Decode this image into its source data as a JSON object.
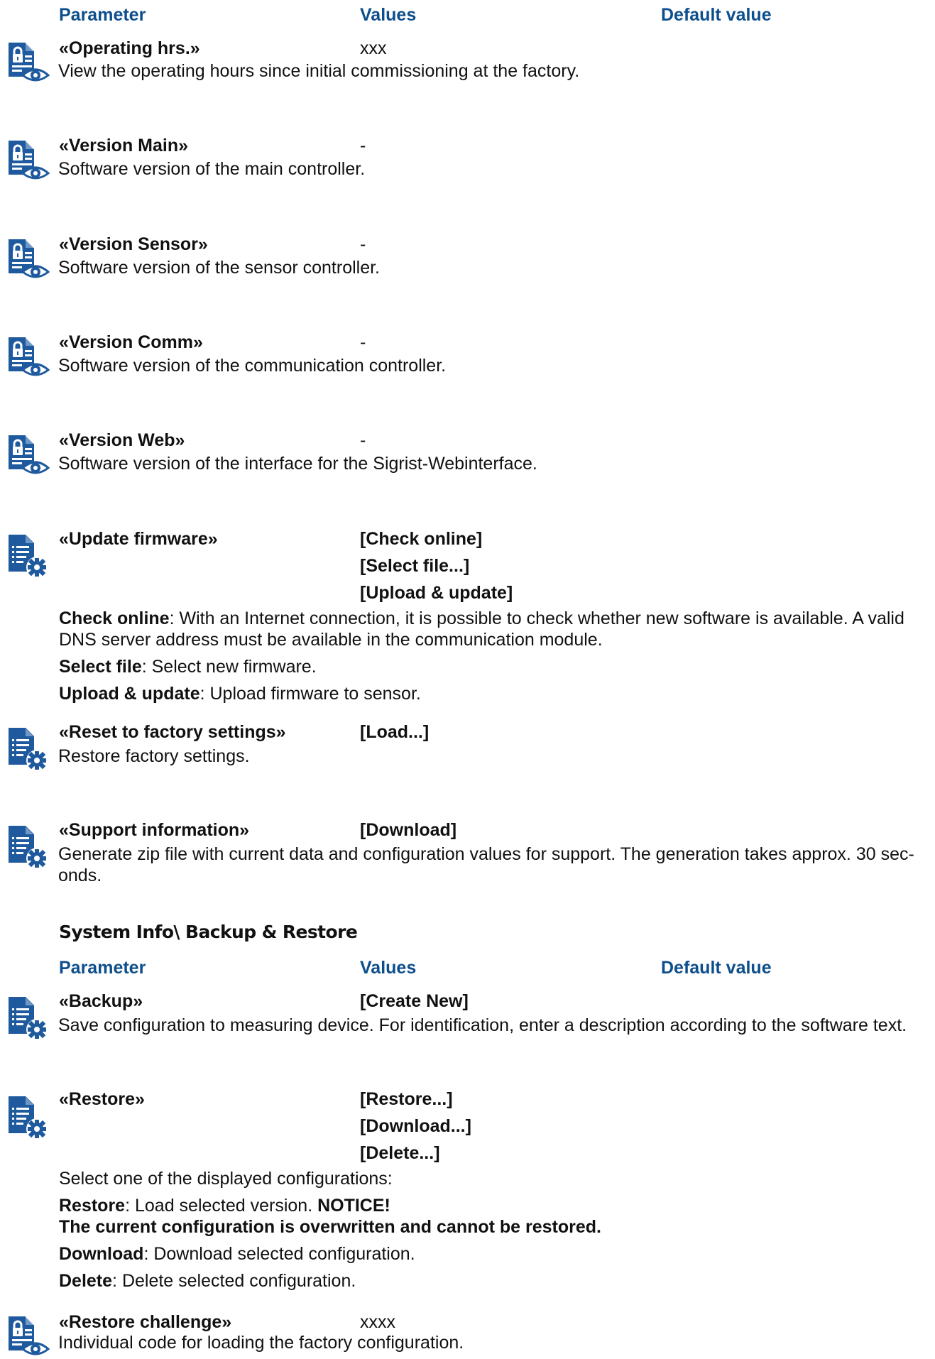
{
  "headers": {
    "parameter": "Parameter",
    "values": "Values",
    "default": "Default value"
  },
  "section2": {
    "title": "System Info\\ Backup & Restore",
    "headers": {
      "parameter": "Parameter",
      "values": "Values",
      "default": "Default value"
    }
  },
  "colors": {
    "header_blue": "#0d4e8c",
    "icon_blue": "#1f5a9e"
  },
  "rows": [
    {
      "icon": "document-lock-eye-icon",
      "name": "«Operating hrs.»",
      "value": "xxx",
      "desc": "View the operating hours since initial commissioning at the factory."
    },
    {
      "icon": "document-lock-eye-icon",
      "name": "«Version Main»",
      "value": "-",
      "desc": "Software version of the main controller."
    },
    {
      "icon": "document-lock-eye-icon",
      "name": "«Version Sensor»",
      "value": "-",
      "desc": "Software version of the sensor controller."
    },
    {
      "icon": "document-lock-eye-icon",
      "name": "«Version Comm»",
      "value": "-",
      "desc": "Software version of the communication controller."
    },
    {
      "icon": "document-lock-eye-icon",
      "name": "«Version Web»",
      "value": "-",
      "desc": "Software version of the interface for the Sigrist-Webinterface."
    },
    {
      "icon": "document-gear-icon",
      "name": "«Update firmware»",
      "values": [
        "[Check online]",
        "[Select file...]",
        "[Upload & update]"
      ],
      "details": [
        {
          "term": "Check online",
          "text": ": With an Internet connection, it is possible to check whether new software is available. A valid DNS server address must be available in the communication module."
        },
        {
          "term": "Select file",
          "text": ": Select new firmware."
        },
        {
          "term": "Upload & update",
          "text": ": Upload firmware to sensor."
        }
      ]
    },
    {
      "icon": "document-gear-icon",
      "name": "«Reset to factory settings»",
      "value": "[Load...]",
      "desc": "Restore factory settings."
    },
    {
      "icon": "document-gear-icon",
      "name": "«Support information»",
      "value": "[Download]",
      "desc": "Generate zip file with current data and configuration values for support. The generation takes approx. 30 sec-",
      "desc2": "onds."
    },
    {
      "icon": "document-gear-icon",
      "name": "«Backup»",
      "value": "[Create New]",
      "desc": "Save configuration to measuring device. For identification, enter a description according to the software text."
    },
    {
      "icon": "document-gear-icon",
      "name": "«Restore»",
      "values": [
        "[Restore...]",
        "[Download...]",
        "[Delete...]"
      ],
      "intro": "Select one of the displayed configurations:",
      "details": [
        {
          "term": "Restore",
          "text": ": Load selected version. ",
          "notice": "NOTICE!",
          "warning": "The current configuration is overwritten and cannot be restored."
        },
        {
          "term": "Download",
          "text": ": Download selected configuration."
        },
        {
          "term": "Delete",
          "text": ": Delete selected configuration."
        }
      ]
    },
    {
      "icon": "document-lock-eye-icon",
      "name": "«Restore challenge»",
      "value": "xxxx",
      "desc": "Individual code for loading the factory configuration."
    }
  ]
}
